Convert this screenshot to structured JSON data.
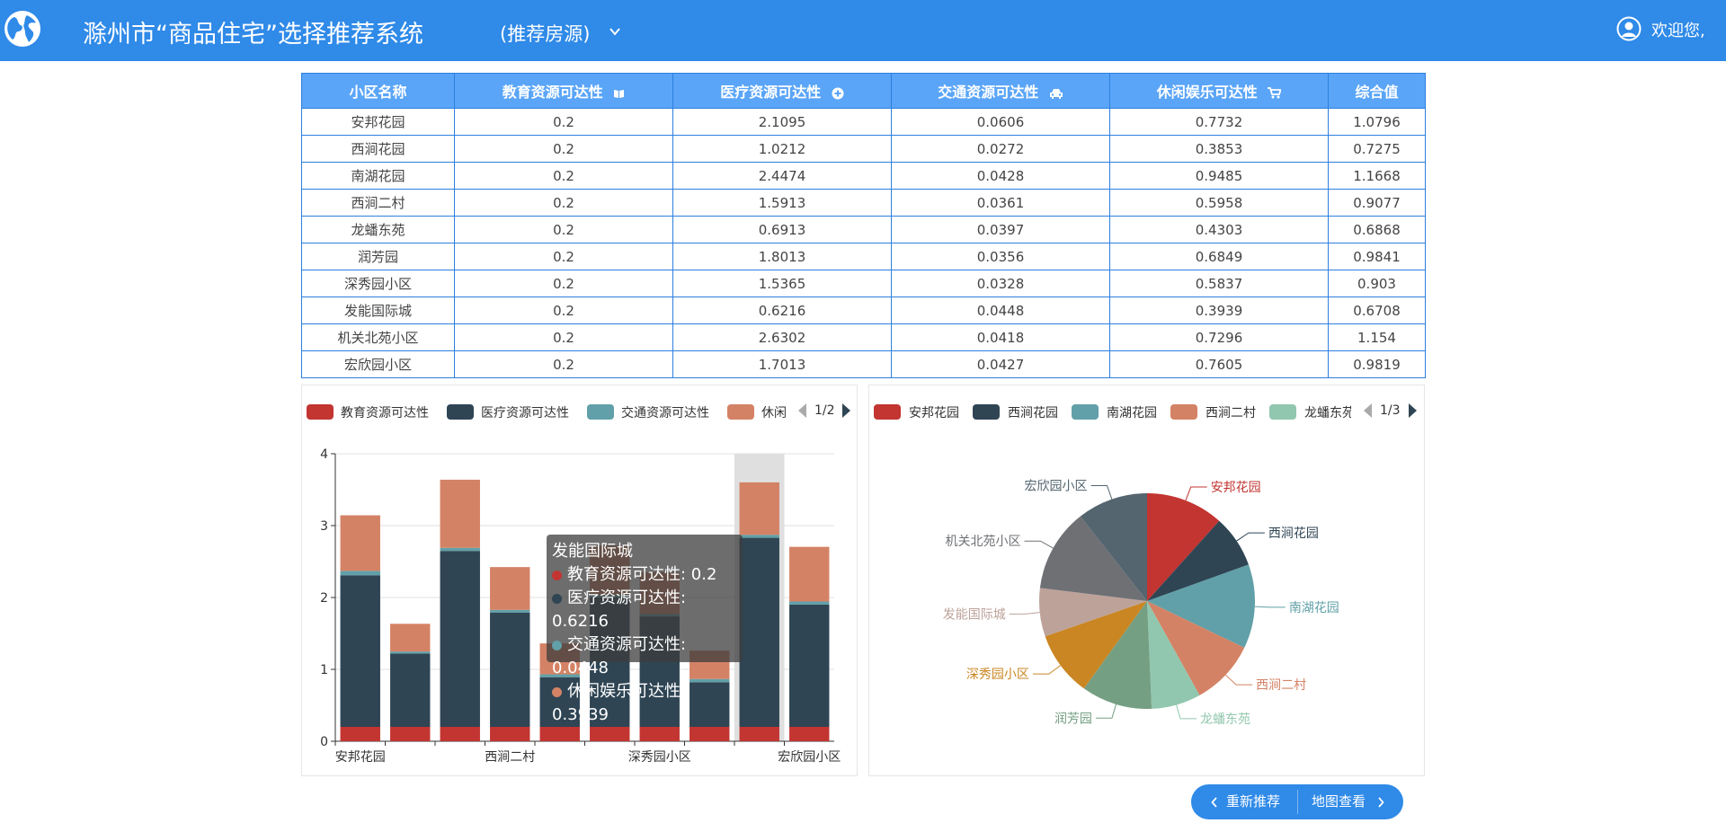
{
  "header": {
    "title": "滁州市“商品住宅”选择推荐系统",
    "subtitle": "(推荐房源)",
    "welcome": "欢迎您,",
    "logo_icon": "globe-icon",
    "bg_color": "#2f8ae8"
  },
  "table": {
    "columns": [
      {
        "label": "小区名称",
        "icon": ""
      },
      {
        "label": "教育资源可达性",
        "icon": "book-icon"
      },
      {
        "label": "医疗资源可达性",
        "icon": "plus-circle-icon"
      },
      {
        "label": "交通资源可达性",
        "icon": "car-icon"
      },
      {
        "label": "休闲娱乐可达性",
        "icon": "cart-icon"
      },
      {
        "label": "综合值",
        "icon": ""
      }
    ],
    "rows": [
      [
        "安邦花园",
        "0.2",
        "2.1095",
        "0.0606",
        "0.7732",
        "1.0796"
      ],
      [
        "西涧花园",
        "0.2",
        "1.0212",
        "0.0272",
        "0.3853",
        "0.7275"
      ],
      [
        "南湖花园",
        "0.2",
        "2.4474",
        "0.0428",
        "0.9485",
        "1.1668"
      ],
      [
        "西涧二村",
        "0.2",
        "1.5913",
        "0.0361",
        "0.5958",
        "0.9077"
      ],
      [
        "龙蟠东苑",
        "0.2",
        "0.6913",
        "0.0397",
        "0.4303",
        "0.6868"
      ],
      [
        "润芳园",
        "0.2",
        "1.8013",
        "0.0356",
        "0.6849",
        "0.9841"
      ],
      [
        "深秀园小区",
        "0.2",
        "1.5365",
        "0.0328",
        "0.5837",
        "0.903"
      ],
      [
        "发能国际城",
        "0.2",
        "0.6216",
        "0.0448",
        "0.3939",
        "0.6708"
      ],
      [
        "机关北苑小区",
        "0.2",
        "2.6302",
        "0.0418",
        "0.7296",
        "1.154"
      ],
      [
        "宏欣园小区",
        "0.2",
        "1.7013",
        "0.0427",
        "0.7605",
        "0.9819"
      ]
    ]
  },
  "chart_data": [
    {
      "type": "bar",
      "stacked": true,
      "categories": [
        "安邦花园",
        "西涧花园",
        "南湖花园",
        "西涧二村",
        "龙蟠东苑",
        "润芳园",
        "深秀园小区",
        "发能国际城",
        "机关北苑小区",
        "宏欣园小区"
      ],
      "x_tick_labels_shown": [
        "安邦花园",
        "西涧二村",
        "深秀园小区",
        "宏欣园小区"
      ],
      "series": [
        {
          "name": "教育资源可达性",
          "color": "#c23531",
          "values": [
            0.2,
            0.2,
            0.2,
            0.2,
            0.2,
            0.2,
            0.2,
            0.2,
            0.2,
            0.2
          ]
        },
        {
          "name": "医疗资源可达性",
          "color": "#2f4554",
          "values": [
            2.1095,
            1.0212,
            2.4474,
            1.5913,
            0.6913,
            1.8013,
            1.5365,
            0.6216,
            2.6302,
            1.7013
          ]
        },
        {
          "name": "交通资源可达性",
          "color": "#61a0a8",
          "values": [
            0.0606,
            0.0272,
            0.0428,
            0.0361,
            0.0397,
            0.0356,
            0.0328,
            0.0448,
            0.0418,
            0.0427
          ]
        },
        {
          "name": "休闲娱乐可达性",
          "color": "#d48265",
          "values": [
            0.7732,
            0.3853,
            0.9485,
            0.5958,
            0.4303,
            0.6849,
            0.5837,
            0.3939,
            0.7296,
            0.7605
          ]
        }
      ],
      "ylim": [
        0,
        4
      ],
      "yticks": [
        0,
        1,
        2,
        3,
        4
      ],
      "grid": true,
      "legend": {
        "position": "top",
        "visible_labels": [
          "教育资源可达性",
          "医疗资源可达性",
          "交通资源可达性",
          "休闲"
        ],
        "page": "1/2"
      },
      "highlight_category": "机关北苑小区",
      "tooltip": {
        "title": "发能国际城",
        "lines": [
          "教育资源可达性: 0.2",
          "医疗资源可达性: 0.6216",
          "交通资源可达性: 0.0448",
          "休闲娱乐可达性: 0.3939"
        ]
      }
    },
    {
      "type": "pie",
      "slices": [
        {
          "name": "安邦花园",
          "value": 1.0796,
          "color": "#c23531"
        },
        {
          "name": "西涧花园",
          "value": 0.7275,
          "color": "#2f4554"
        },
        {
          "name": "南湖花园",
          "value": 1.1668,
          "color": "#61a0a8"
        },
        {
          "name": "西涧二村",
          "value": 0.9077,
          "color": "#d48265"
        },
        {
          "name": "龙蟠东苑",
          "value": 0.6868,
          "color": "#91c7ae"
        },
        {
          "name": "润芳园",
          "value": 0.9841,
          "color": "#749f83"
        },
        {
          "name": "深秀园小区",
          "value": 0.903,
          "color": "#ca8622"
        },
        {
          "name": "发能国际城",
          "value": 0.6708,
          "color": "#bda29a"
        },
        {
          "name": "机关北苑小区",
          "value": 1.154,
          "color": "#6e7074"
        },
        {
          "name": "宏欣园小区",
          "value": 0.9819,
          "color": "#546570"
        }
      ],
      "legend": {
        "position": "top",
        "visible_labels": [
          "安邦花园",
          "西涧花园",
          "南湖花园",
          "西涧二村",
          "龙蟠东苑"
        ],
        "page": "1/3"
      }
    }
  ],
  "buttons": {
    "recommend": "重新推荐",
    "map": "地图查看"
  }
}
